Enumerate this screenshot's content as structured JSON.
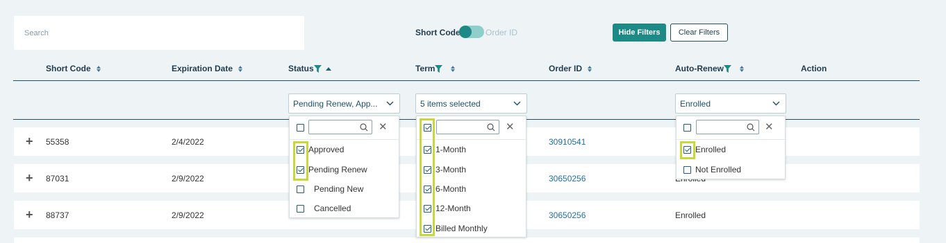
{
  "search": {
    "placeholder": "Search"
  },
  "toggle": {
    "left_label": "Short Code",
    "right_label": "Order ID"
  },
  "buttons": {
    "hide_filters": "Hide Filters",
    "clear_filters": "Clear Filters"
  },
  "columns": {
    "short_code": "Short Code",
    "expiration_date": "Expiration Date",
    "status": "Status",
    "term": "Term",
    "order_id": "Order ID",
    "auto_renew": "Auto-Renew",
    "action": "Action"
  },
  "filters": {
    "status_value": "Pending Renew, App...",
    "term_value": "5 items selected",
    "auto_renew_value": "Enrolled"
  },
  "rows": [
    {
      "short_code": "55358",
      "expiration_date": "2/4/2022",
      "order_id": "30910541",
      "auto_renew": ""
    },
    {
      "short_code": "87031",
      "expiration_date": "2/9/2022",
      "order_id": "30650256",
      "auto_renew": "Enrolled"
    },
    {
      "short_code": "88737",
      "expiration_date": "2/9/2022",
      "order_id": "30650256",
      "auto_renew": "Enrolled"
    }
  ],
  "status_options": [
    {
      "label": "Approved",
      "checked": true
    },
    {
      "label": "Pending Renew",
      "checked": true
    },
    {
      "label": "Pending New",
      "checked": false
    },
    {
      "label": "Cancelled",
      "checked": false
    }
  ],
  "term_options": [
    {
      "label": "1-Month",
      "checked": true
    },
    {
      "label": "3-Month",
      "checked": true
    },
    {
      "label": "6-Month",
      "checked": true
    },
    {
      "label": "12-Month",
      "checked": true
    },
    {
      "label": "Billed Monthly",
      "checked": true
    }
  ],
  "auto_renew_options": [
    {
      "label": "Enrolled",
      "checked": true
    },
    {
      "label": "Not Enrolled",
      "checked": false
    }
  ],
  "colors": {
    "accent": "#1e8a85",
    "highlight": "#c7d83a",
    "header_text": "#1f3b4d",
    "link": "#1f6fa7"
  }
}
